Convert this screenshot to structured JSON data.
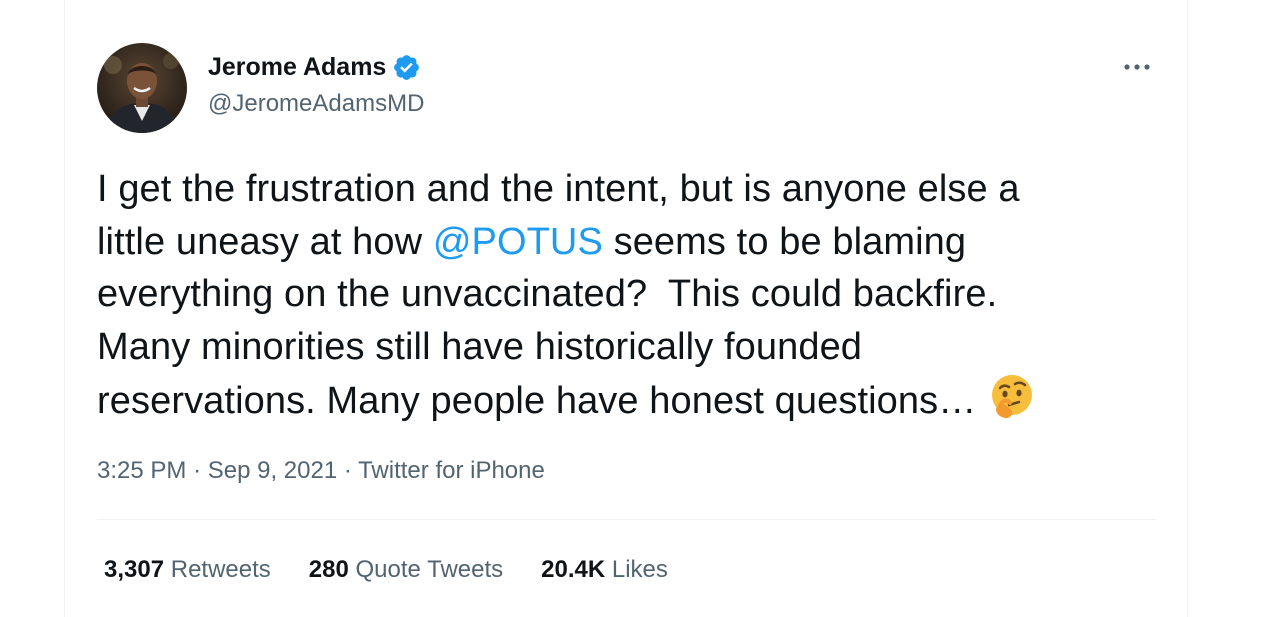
{
  "author": {
    "name": "Jerome Adams",
    "handle": "@JeromeAdamsMD",
    "verified": true
  },
  "tweet": {
    "text_before_mention": "I get the frustration and the intent, but is anyone else a\nlittle uneasy at how ",
    "mention": "@POTUS",
    "text_after_mention": " seems to be blaming\neverything on the unvaccinated?  This could backfire.\nMany minorities still have historically founded\nreservations. Many people have honest questions…",
    "emoji": "thinking-face"
  },
  "meta": {
    "time": "3:25 PM",
    "separator": "·",
    "date": "Sep 9, 2021",
    "source": "Twitter for iPhone"
  },
  "stats": [
    {
      "count": "3,307",
      "label": "Retweets"
    },
    {
      "count": "280",
      "label": "Quote Tweets"
    },
    {
      "count": "20.4K",
      "label": "Likes"
    }
  ],
  "colors": {
    "accent": "#1d9bf0",
    "text": "#0f1419",
    "secondary": "#536471",
    "border": "#eff3f4"
  }
}
